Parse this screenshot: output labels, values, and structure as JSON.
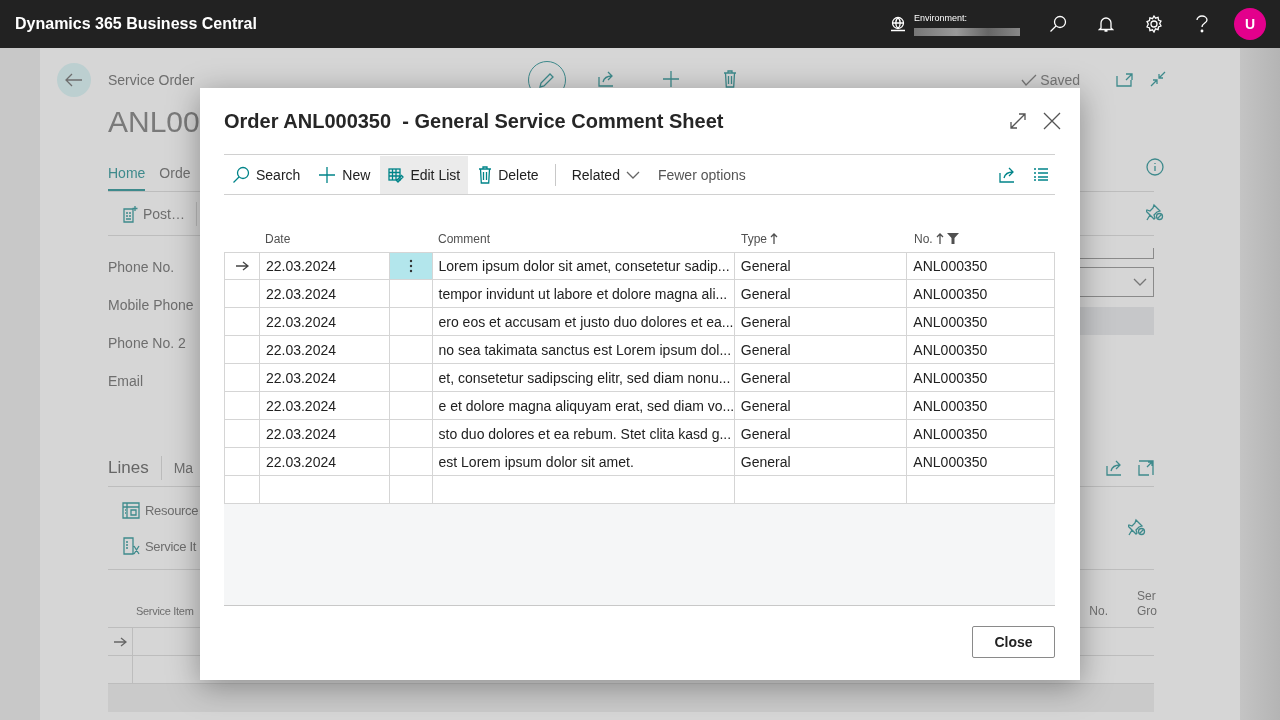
{
  "app_bar": {
    "title": "Dynamics 365 Business Central",
    "environment_label": "Environment:",
    "avatar": "U"
  },
  "page": {
    "breadcrumb": "Service Order",
    "title": "ANL00",
    "status": "Saved",
    "tabs": [
      {
        "label": "Home",
        "selected": true
      },
      {
        "label": "Orde",
        "selected": false
      }
    ],
    "actions": [
      "Post…"
    ],
    "fields": [
      "Phone No.",
      "Mobile Phone",
      "Phone No. 2",
      "Email"
    ],
    "lines": {
      "title": "Lines",
      "tabs": [
        "Ma"
      ],
      "actions": [
        "Resource",
        "Service It"
      ],
      "columns": [
        {
          "lines": [
            "Service Item"
          ]
        },
        {
          "lines": [
            "No."
          ]
        },
        {
          "lines": [
            "Ser",
            "Gro"
          ]
        }
      ]
    }
  },
  "dialog": {
    "title": "Order ANL000350  - General Service Comment Sheet",
    "actions": [
      {
        "label": "Search",
        "kind": "button",
        "selected": false
      },
      {
        "label": "New",
        "kind": "button",
        "selected": false
      },
      {
        "label": "Edit List",
        "kind": "button",
        "selected": true
      },
      {
        "label": "Delete",
        "kind": "button",
        "selected": false
      },
      {
        "label": "Related",
        "kind": "menu",
        "selected": false
      },
      {
        "label": "Fewer options",
        "kind": "link",
        "selected": false
      }
    ],
    "columns": [
      {
        "label": "Date",
        "sorted": false,
        "filtered": false
      },
      {
        "label": "Comment",
        "sorted": false,
        "filtered": false
      },
      {
        "label": "Type",
        "sorted": true,
        "filtered": false
      },
      {
        "label": "No.",
        "sorted": true,
        "filtered": true
      }
    ],
    "rows": [
      {
        "date": "22.03.2024",
        "comment": "Lorem ipsum dolor sit amet, consetetur sadip...",
        "type": "General",
        "no": "ANL000350",
        "selected": true
      },
      {
        "date": "22.03.2024",
        "comment": "tempor invidunt ut labore et dolore magna ali...",
        "type": "General",
        "no": "ANL000350",
        "selected": false
      },
      {
        "date": "22.03.2024",
        "comment": "ero eos et accusam et justo duo dolores et ea...",
        "type": "General",
        "no": "ANL000350",
        "selected": false
      },
      {
        "date": "22.03.2024",
        "comment": "no sea takimata sanctus est Lorem ipsum dol...",
        "type": "General",
        "no": "ANL000350",
        "selected": false
      },
      {
        "date": "22.03.2024",
        "comment": "et, consetetur sadipscing elitr, sed diam nonu...",
        "type": "General",
        "no": "ANL000350",
        "selected": false
      },
      {
        "date": "22.03.2024",
        "comment": "e et dolore magna aliquyam erat, sed diam vo...",
        "type": "General",
        "no": "ANL000350",
        "selected": false
      },
      {
        "date": "22.03.2024",
        "comment": "sto duo dolores et ea rebum. Stet clita kasd g...",
        "type": "General",
        "no": "ANL000350",
        "selected": false
      },
      {
        "date": "22.03.2024",
        "comment": "est Lorem ipsum dolor sit amet.",
        "type": "General",
        "no": "ANL000350",
        "selected": false
      }
    ],
    "close_button": "Close"
  }
}
